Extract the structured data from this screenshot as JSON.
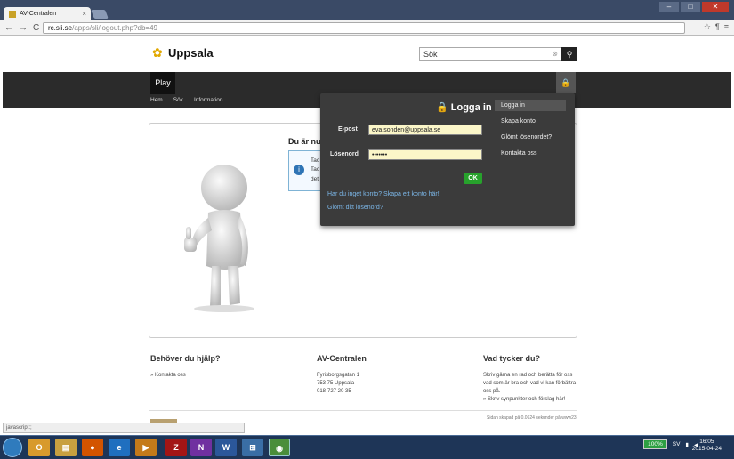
{
  "browser": {
    "tab_title": "AV-Centralen",
    "tab_close": "×",
    "url_host": "rc.sli.se",
    "url_path": "/apps/sli/logout.php?db=49",
    "back": "←",
    "forward": "→",
    "reload": "C",
    "window_min": "–",
    "window_max": "□",
    "window_close": "✕"
  },
  "header": {
    "logo_text": "Uppsala",
    "search_value": "Sök",
    "search_clear": "⊗",
    "search_button": "🔍"
  },
  "nav": {
    "active": "Play",
    "items": [
      "Hem",
      "Sök",
      "Information"
    ],
    "lock_icon": "🔒"
  },
  "content": {
    "title": "Du är nu",
    "info_lines": [
      "Tac",
      "Tac",
      "deti"
    ]
  },
  "login": {
    "title": "Logga in",
    "email_label": "E-post",
    "email_value": "eva.sonden@uppsala.se",
    "password_label": "Lösenord",
    "password_value": "•••••••",
    "ok": "OK",
    "create_account": "Har du inget konto? Skapa ett konto här!",
    "forgot": "Glömt ditt lösenord?",
    "menu": [
      "Logga in",
      "Skapa konto",
      "Glömt lösenordet?",
      "Kontakta oss"
    ]
  },
  "footer": {
    "col1_title": "Behöver du hjälp?",
    "col1_link": "» Kontakta oss",
    "col2_title": "AV-Centralen",
    "col2_lines": [
      "Fyrisborgsgatan 1",
      "753 75 Uppsala",
      "018-727 20 35"
    ],
    "col3_title": "Vad tycker du?",
    "col3_text": "Skriv gärna en rad och berätta för oss vad som är bra och vad vi kan förbättra oss på.",
    "col3_link": "» Skriv synpunkter och förslag här!",
    "created": "Sidan skapad på 0.0624 sekunder på www23"
  },
  "status_bar": "javascript:;",
  "taskbar": {
    "battery": "100%",
    "lang": "SV",
    "time": "16:05",
    "date": "2015-04-24"
  }
}
